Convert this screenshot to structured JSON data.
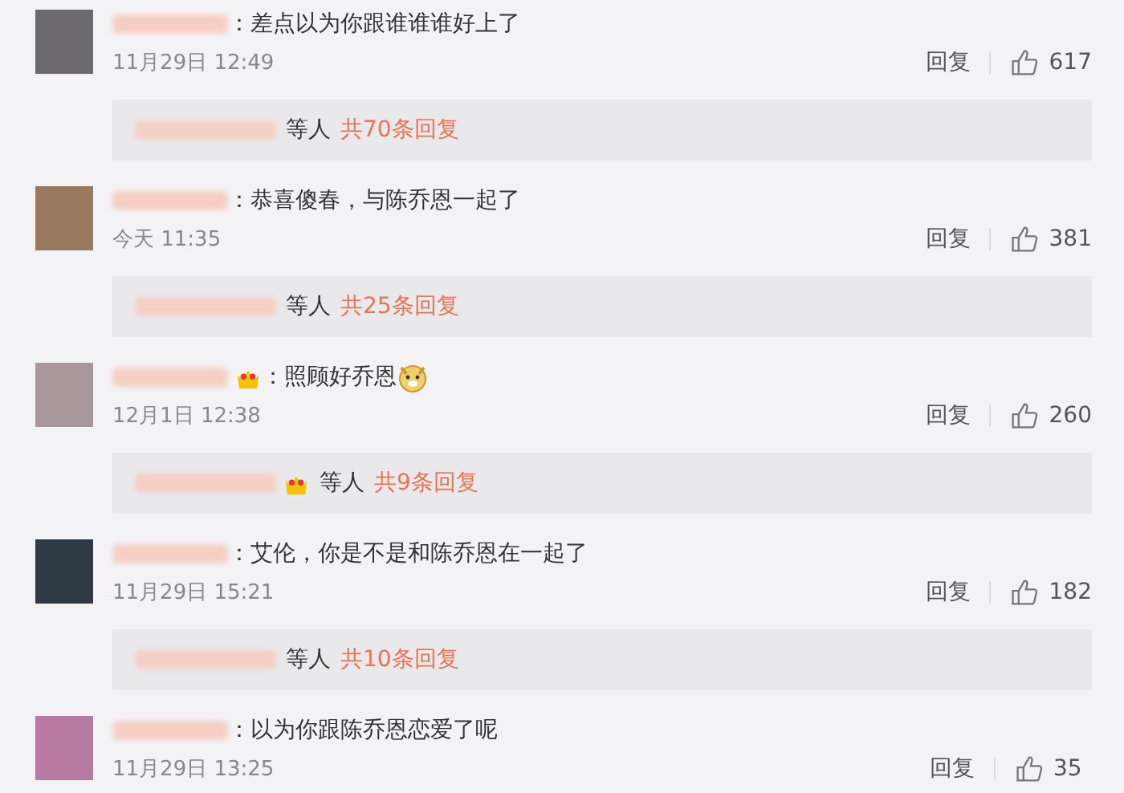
{
  "comments": [
    {
      "text": "：差点以为你跟谁谁谁好上了",
      "badge": false,
      "emoji": false,
      "time": "11月29日 12:49",
      "reply_label": "回复",
      "likes": "617",
      "replies": {
        "badge": false,
        "suffix": "等人",
        "count": "共70条回复"
      }
    },
    {
      "text": "：恭喜傻春，与陈乔恩一起了",
      "badge": false,
      "emoji": false,
      "time": "今天 11:35",
      "reply_label": "回复",
      "likes": "381",
      "replies": {
        "badge": false,
        "suffix": "等人",
        "count": "共25条回复"
      }
    },
    {
      "text": "：照顾好乔恩",
      "badge": true,
      "emoji": true,
      "time": "12月1日 12:38",
      "reply_label": "回复",
      "likes": "260",
      "replies": {
        "badge": true,
        "suffix": "等人",
        "count": "共9条回复"
      }
    },
    {
      "text": "：艾伦，你是不是和陈乔恩在一起了",
      "badge": false,
      "emoji": false,
      "time": "11月29日 15:21",
      "reply_label": "回复",
      "likes": "182",
      "replies": {
        "badge": false,
        "suffix": "等人",
        "count": "共10条回复"
      }
    },
    {
      "text": "：以为你跟陈乔恩恋爱了呢",
      "badge": false,
      "emoji": false,
      "time": "11月29日 13:25",
      "reply_label": "回复",
      "likes": "35"
    }
  ]
}
